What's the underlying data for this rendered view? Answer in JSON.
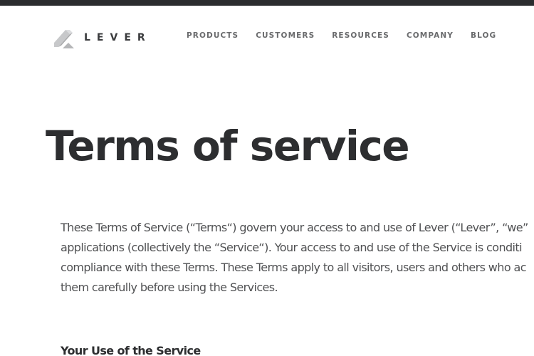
{
  "brand": {
    "name": "LEVER",
    "logo_icon": "lever-logo-icon",
    "colors": {
      "topbar": "#2b2c2e",
      "text": "#2d2e30",
      "nav": "#6a6b6d",
      "body_text": "#505153"
    }
  },
  "nav": {
    "items": [
      {
        "label": "PRODUCTS"
      },
      {
        "label": "CUSTOMERS"
      },
      {
        "label": "RESOURCES"
      },
      {
        "label": "COMPANY"
      },
      {
        "label": "BLOG"
      }
    ]
  },
  "page": {
    "title": "Terms of service",
    "intro_lines": [
      "These Terms of Service (“Terms“) govern your access to and use of Lever (“Lever”, “we”",
      "applications (collectively the “Service“). Your access to and use of the Service is conditi",
      "compliance with these Terms. These Terms apply to all visitors, users and others who ac",
      "them carefully before using the Services."
    ],
    "sections": [
      {
        "heading": "Your Use of the Service"
      }
    ]
  }
}
